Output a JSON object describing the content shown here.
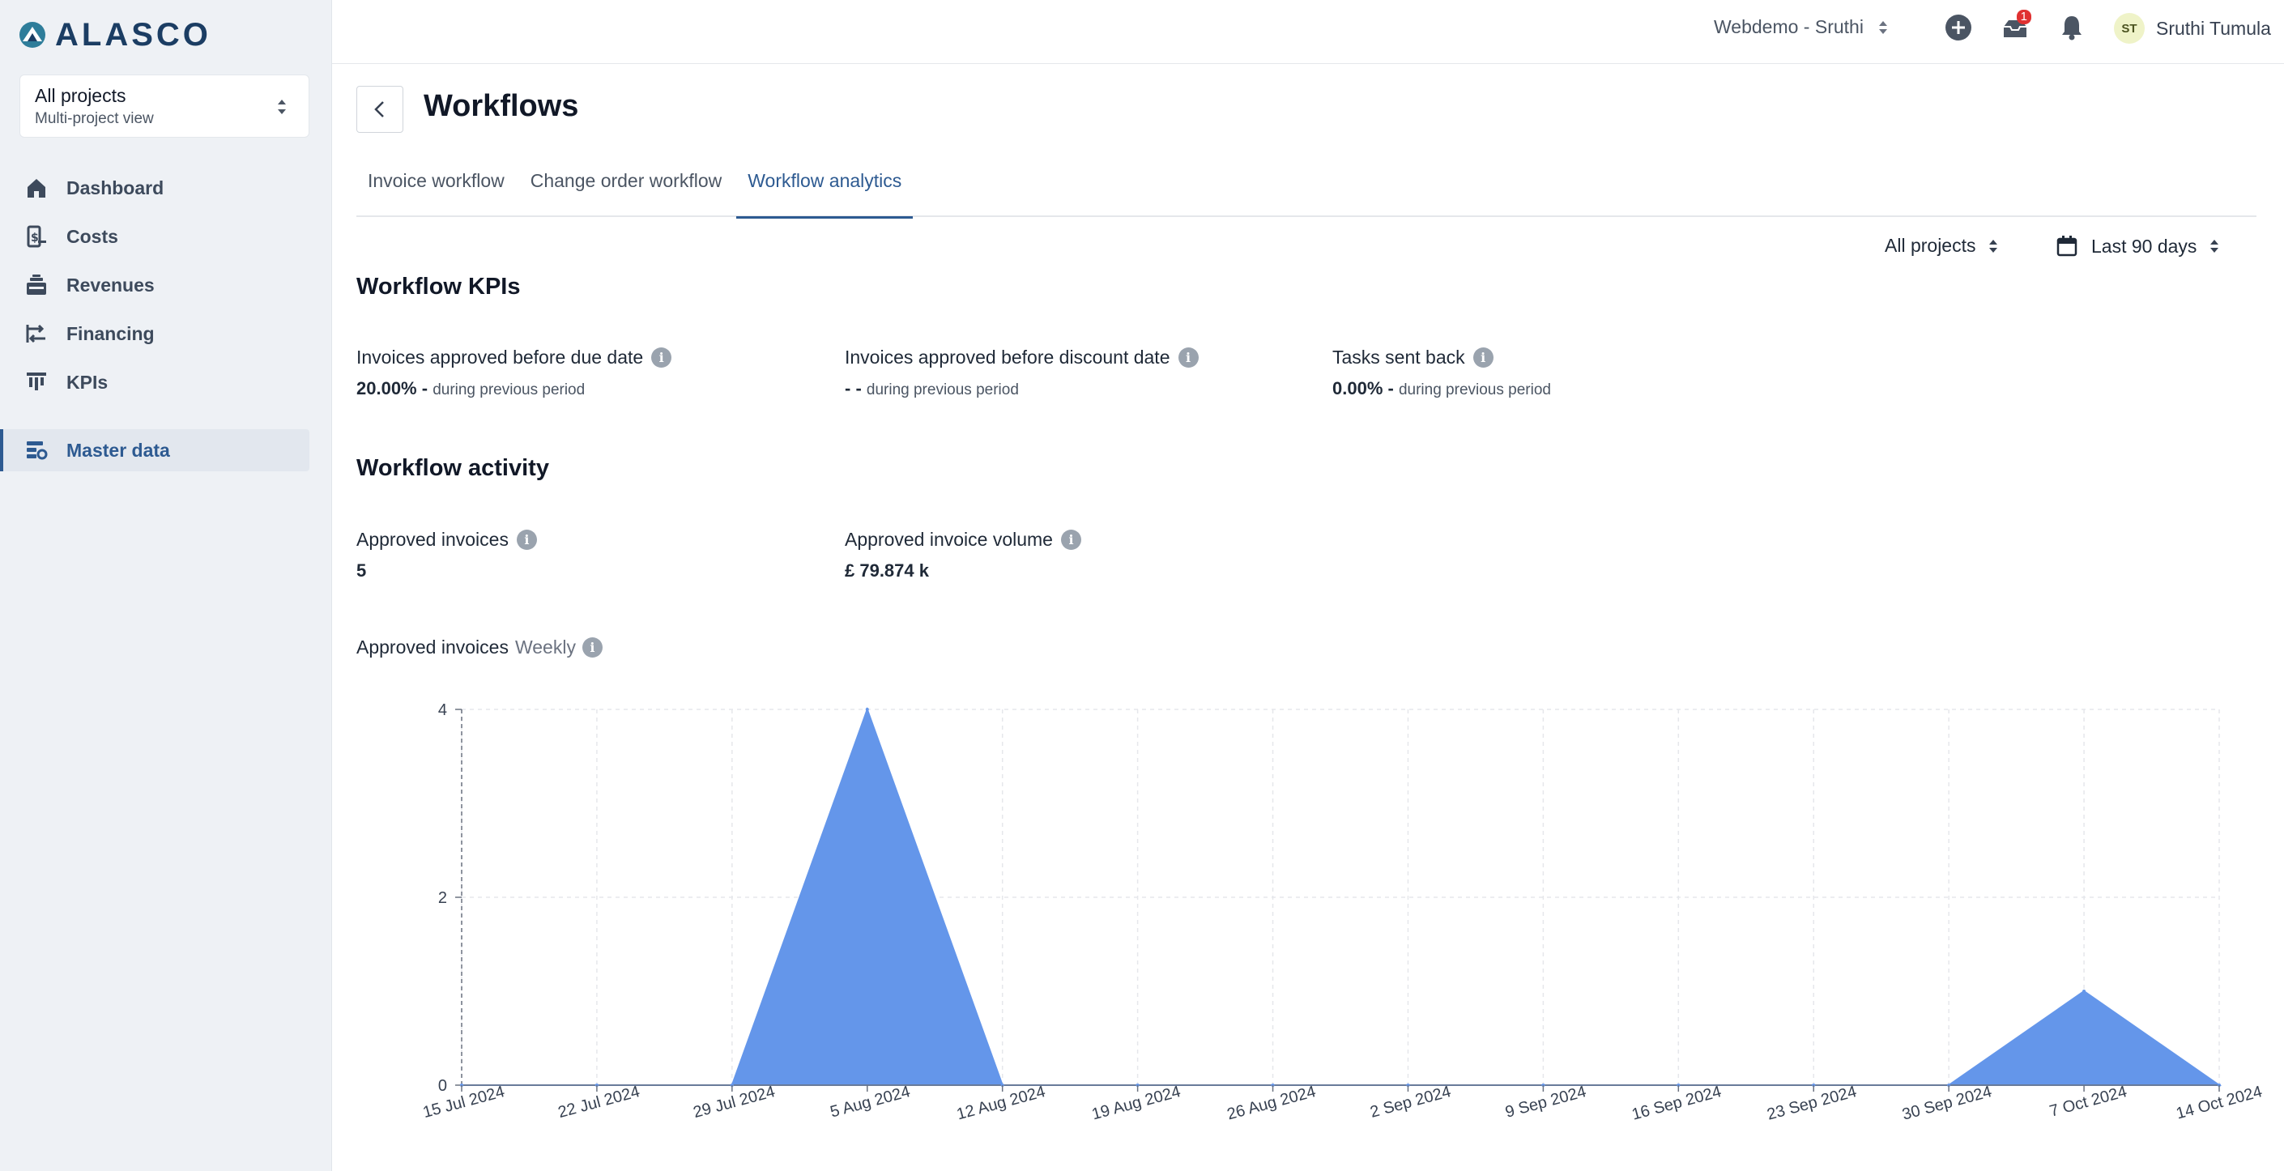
{
  "brand": {
    "name": "ALASCO"
  },
  "project_selector": {
    "title": "All projects",
    "subtitle": "Multi-project view"
  },
  "nav": {
    "items": [
      {
        "label": "Dashboard",
        "icon": "home-icon"
      },
      {
        "label": "Costs",
        "icon": "costs-icon"
      },
      {
        "label": "Revenues",
        "icon": "revenues-icon"
      },
      {
        "label": "Financing",
        "icon": "financing-icon"
      },
      {
        "label": "KPIs",
        "icon": "kpis-icon"
      }
    ],
    "master_data": {
      "label": "Master data",
      "icon": "master-data-icon",
      "active": true
    }
  },
  "topbar": {
    "workspace": "Webdemo - Sruthi",
    "inbox_badge": "1",
    "user_initials": "ST",
    "user_name": "Sruthi Tumula"
  },
  "page": {
    "title": "Workflows"
  },
  "tabs": [
    {
      "label": "Invoice workflow",
      "active": false
    },
    {
      "label": "Change order workflow",
      "active": false
    },
    {
      "label": "Workflow analytics",
      "active": true
    }
  ],
  "filters": {
    "projects": "All projects",
    "period": "Last 90 days"
  },
  "kpis": {
    "title": "Workflow KPIs",
    "items": [
      {
        "label": "Invoices approved before due date",
        "value": "20.00%",
        "suffix": " - ",
        "sub": "during previous period"
      },
      {
        "label": "Invoices approved before discount date",
        "value": "- -",
        "suffix": " ",
        "sub": "during previous period"
      },
      {
        "label": "Tasks sent back",
        "value": "0.00%",
        "suffix": " - ",
        "sub": "during previous period"
      }
    ]
  },
  "activity": {
    "title": "Workflow activity",
    "items": [
      {
        "label": "Approved invoices",
        "value": "5"
      },
      {
        "label": "Approved invoice volume",
        "value": "£ 79.874 k"
      }
    ]
  },
  "chart_header": {
    "title": "Approved invoices",
    "granularity": "Weekly"
  },
  "colors": {
    "accent": "#2d5a91",
    "area": "#6496ea"
  },
  "chart_data": {
    "type": "area",
    "title": "Approved invoices",
    "x": [
      "15 Jul 2024",
      "22 Jul 2024",
      "29 Jul 2024",
      "5 Aug 2024",
      "12 Aug 2024",
      "19 Aug 2024",
      "26 Aug 2024",
      "2 Sep 2024",
      "9 Sep 2024",
      "16 Sep 2024",
      "23 Sep 2024",
      "30 Sep 2024",
      "7 Oct 2024",
      "14 Oct 2024"
    ],
    "values": [
      0,
      0,
      0,
      4,
      0,
      0,
      0,
      0,
      0,
      0,
      0,
      0,
      1,
      0
    ],
    "yticks": [
      0,
      2,
      4
    ],
    "ylim": [
      0,
      4
    ],
    "grid": true,
    "legend": "none"
  }
}
